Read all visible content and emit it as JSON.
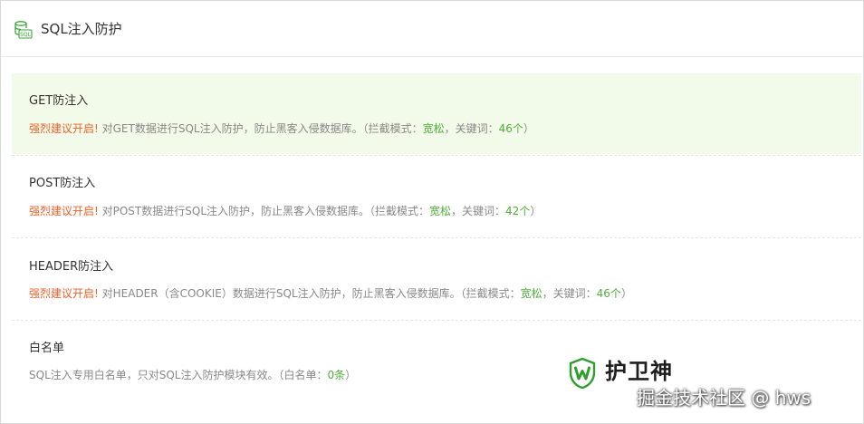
{
  "header": {
    "icon": "sql-database-icon",
    "title": "SQL注入防护"
  },
  "items": [
    {
      "title": "GET防注入",
      "warn": "强烈建议开启!",
      "desc": " 对GET数据进行SQL注入防护，防止黑客入侵数据库。（拦截模式：",
      "mode": "宽松",
      "kw_label": "，关键词：",
      "kw_count": "46个",
      "tail": "）"
    },
    {
      "title": "POST防注入",
      "warn": "强烈建议开启!",
      "desc": " 对POST数据进行SQL注入防护，防止黑客入侵数据库。（拦截模式：",
      "mode": "宽松",
      "kw_label": "，关键词：",
      "kw_count": "42个",
      "tail": "）"
    },
    {
      "title": "HEADER防注入",
      "warn": "强烈建议开启!",
      "desc": " 对HEADER（含COOKIE）数据进行SQL注入防护，防止黑客入侵数据库。（拦截模式：",
      "mode": "宽松",
      "kw_label": "，关键词：",
      "kw_count": "46个",
      "tail": "）"
    },
    {
      "title": "白名单",
      "desc": "SQL注入专用白名单，只对SQL注入防护模块有效。（白名单：",
      "count": "0条",
      "tail": "）"
    }
  ],
  "watermark": {
    "logo_icon": "shield-w-icon",
    "brand": "护卫神",
    "credit": "掘金技术社区 @ hws",
    "brand_color": "#2f9e2f"
  }
}
